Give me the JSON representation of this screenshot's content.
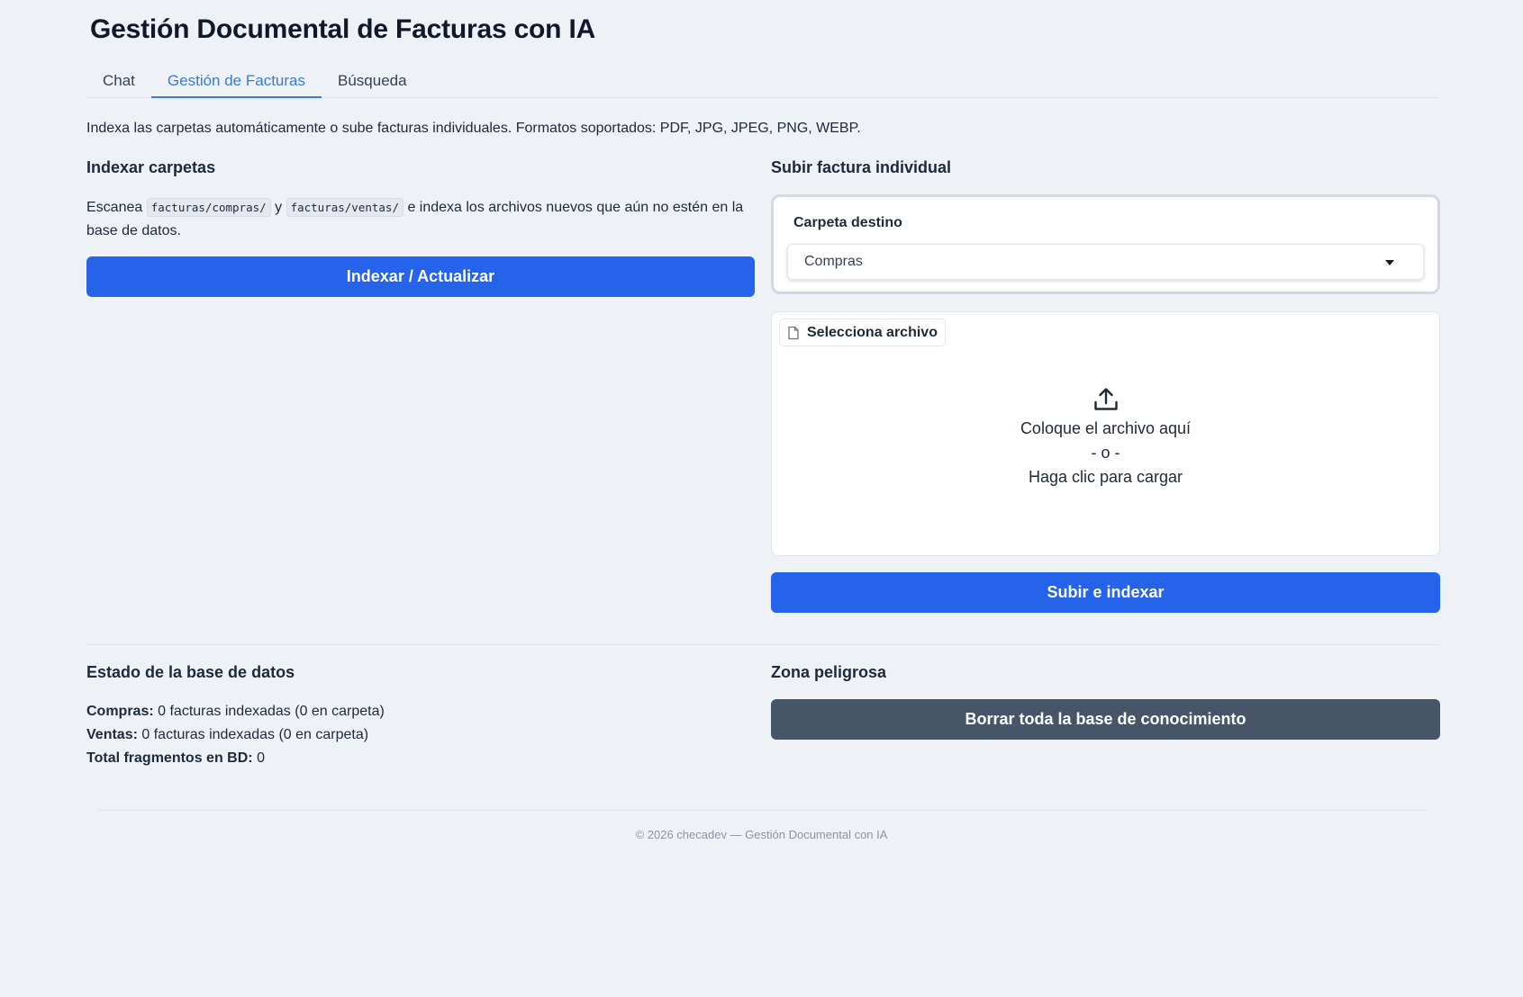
{
  "app": {
    "title": "Gestión Documental de Facturas con IA"
  },
  "tabs": [
    {
      "label": "Chat",
      "active": false
    },
    {
      "label": "Gestión de Facturas",
      "active": true
    },
    {
      "label": "Búsqueda",
      "active": false
    }
  ],
  "intro": "Indexa las carpetas automáticamente o sube facturas individuales. Formatos soportados: PDF, JPG, JPEG, PNG, WEBP.",
  "index_section": {
    "title": "Indexar carpetas",
    "text_prefix": "Escanea",
    "path_compras": "facturas/compras/",
    "text_and": "y",
    "path_ventas": "facturas/ventas/",
    "text_suffix": "e indexa los archivos nuevos que aún no estén en la base de datos.",
    "button_label": "Indexar / Actualizar"
  },
  "upload_section": {
    "title": "Subir factura individual",
    "dest_label": "Carpeta destino",
    "dest_value": "Compras",
    "file_chip_label": "Selecciona archivo",
    "drop_line1": "Coloque el archivo aquí",
    "drop_line2": "- o -",
    "drop_line3": "Haga clic para cargar",
    "button_label": "Subir e indexar"
  },
  "db_status": {
    "title": "Estado de la base de datos",
    "compras_label": "Compras:",
    "compras_value": "0 facturas indexadas (0 en carpeta)",
    "ventas_label": "Ventas:",
    "ventas_value": "0 facturas indexadas (0 en carpeta)",
    "total_label": "Total fragmentos en BD:",
    "total_value": "0"
  },
  "danger_zone": {
    "title": "Zona peligrosa",
    "button_label": "Borrar toda la base de conocimiento"
  },
  "footer": {
    "text": "© 2026 checadev — Gestión Documental con IA"
  },
  "colors": {
    "primary": "#2563eb",
    "danger_button": "#475569",
    "active_tab": "#3b7bd8",
    "background": "#eef2f7"
  }
}
